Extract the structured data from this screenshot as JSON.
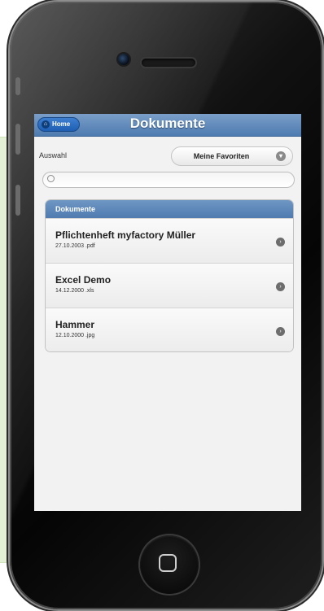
{
  "header": {
    "home_label": "Home",
    "title": "Dokumente"
  },
  "filter": {
    "label": "Auswahl",
    "selected": "Meine Favoriten"
  },
  "search": {
    "value": "",
    "placeholder": ""
  },
  "list": {
    "heading": "Dokumente",
    "items": [
      {
        "title": "Pflichtenheft myfactory Müller",
        "subtitle": "27.10.2003 .pdf"
      },
      {
        "title": "Excel Demo",
        "subtitle": "14.12.2000 .xls"
      },
      {
        "title": "Hammer",
        "subtitle": "12.10.2000 .jpg"
      }
    ]
  },
  "colors": {
    "header_blue": "#4e7bb0",
    "home_button_blue": "#1e5fb3",
    "background_panel": "#e4f0d6"
  }
}
